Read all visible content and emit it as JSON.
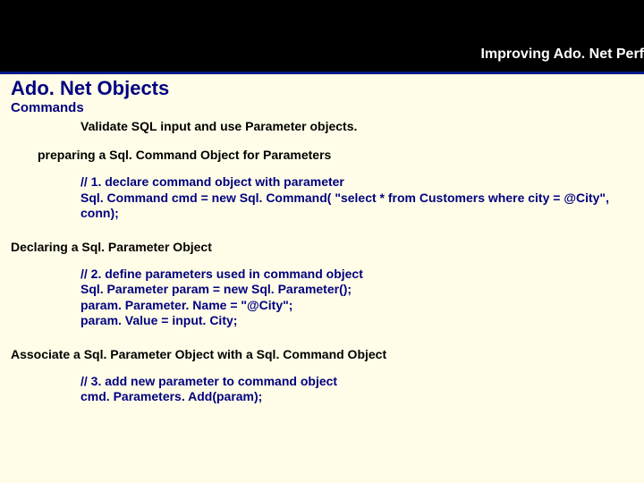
{
  "header": {
    "text": "Improving Ado. Net Perf"
  },
  "title": "Ado. Net Objects",
  "subhead": "Commands",
  "intro": "Validate SQL input and use Parameter objects.",
  "sectionA": "preparing a Sql. Command Object for Parameters",
  "block1": {
    "l1": "// 1. declare command object with parameter",
    "l2": "Sql. Command cmd = new Sql. Command( \"select * from Customers where city = @City\", conn);"
  },
  "sectionB": "Declaring a Sql. Parameter Object",
  "block2": {
    "l1": "// 2. define parameters used in command object",
    "l2": "Sql. Parameter param = new Sql. Parameter();",
    "l3": "param. Parameter. Name = \"@City\";",
    "l4": "param. Value = input. City;"
  },
  "sectionC": "Associate a Sql. Parameter Object with a Sql. Command Object",
  "block3": {
    "l1": "// 3. add new parameter to command object",
    "l2": "cmd. Parameters. Add(param);"
  }
}
